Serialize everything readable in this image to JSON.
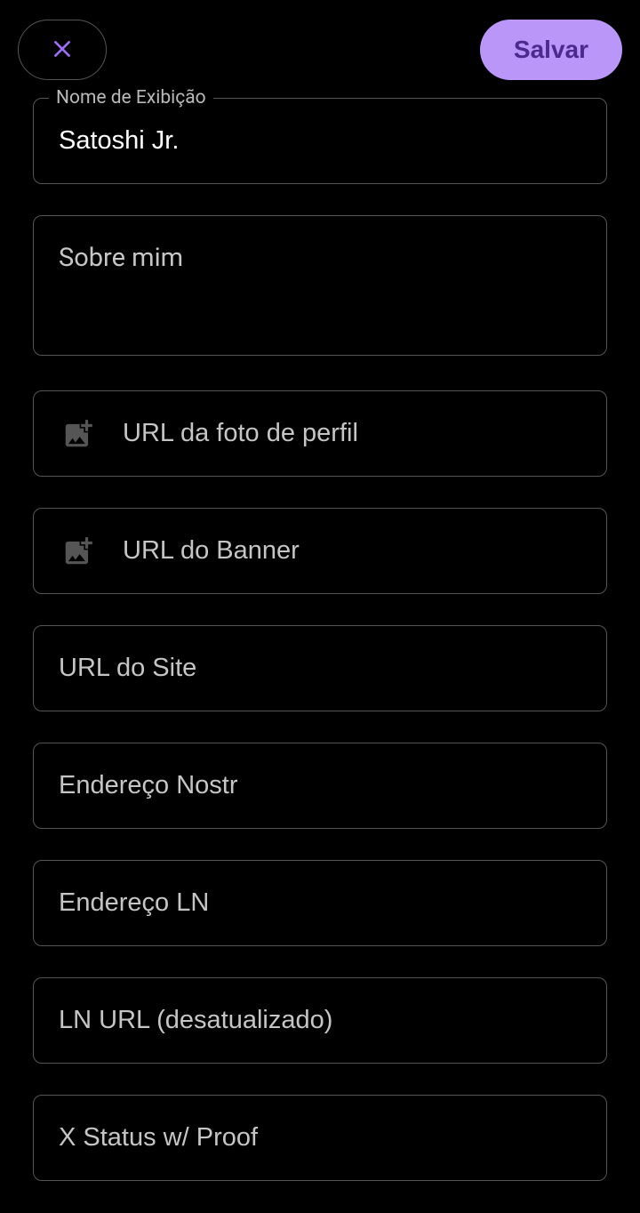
{
  "header": {
    "save_label": "Salvar"
  },
  "form": {
    "display_name": {
      "label": "Nome de Exibição",
      "value": "Satoshi Jr."
    },
    "about": {
      "placeholder": "Sobre mim",
      "value": ""
    },
    "profile_photo_url": {
      "placeholder": "URL da foto de perfil",
      "value": ""
    },
    "banner_url": {
      "placeholder": "URL do Banner",
      "value": ""
    },
    "website_url": {
      "placeholder": "URL do Site",
      "value": ""
    },
    "nostr_address": {
      "placeholder": "Endereço Nostr",
      "value": ""
    },
    "ln_address": {
      "placeholder": "Endereço LN",
      "value": ""
    },
    "ln_url": {
      "placeholder": "LN URL (desatualizado)",
      "value": ""
    },
    "x_status": {
      "placeholder": "X Status w/ Proof",
      "value": ""
    }
  },
  "colors": {
    "accent": "#bb96f9",
    "accent_text": "#4a2a8f",
    "border": "#555555",
    "placeholder": "#c5c5c5"
  }
}
